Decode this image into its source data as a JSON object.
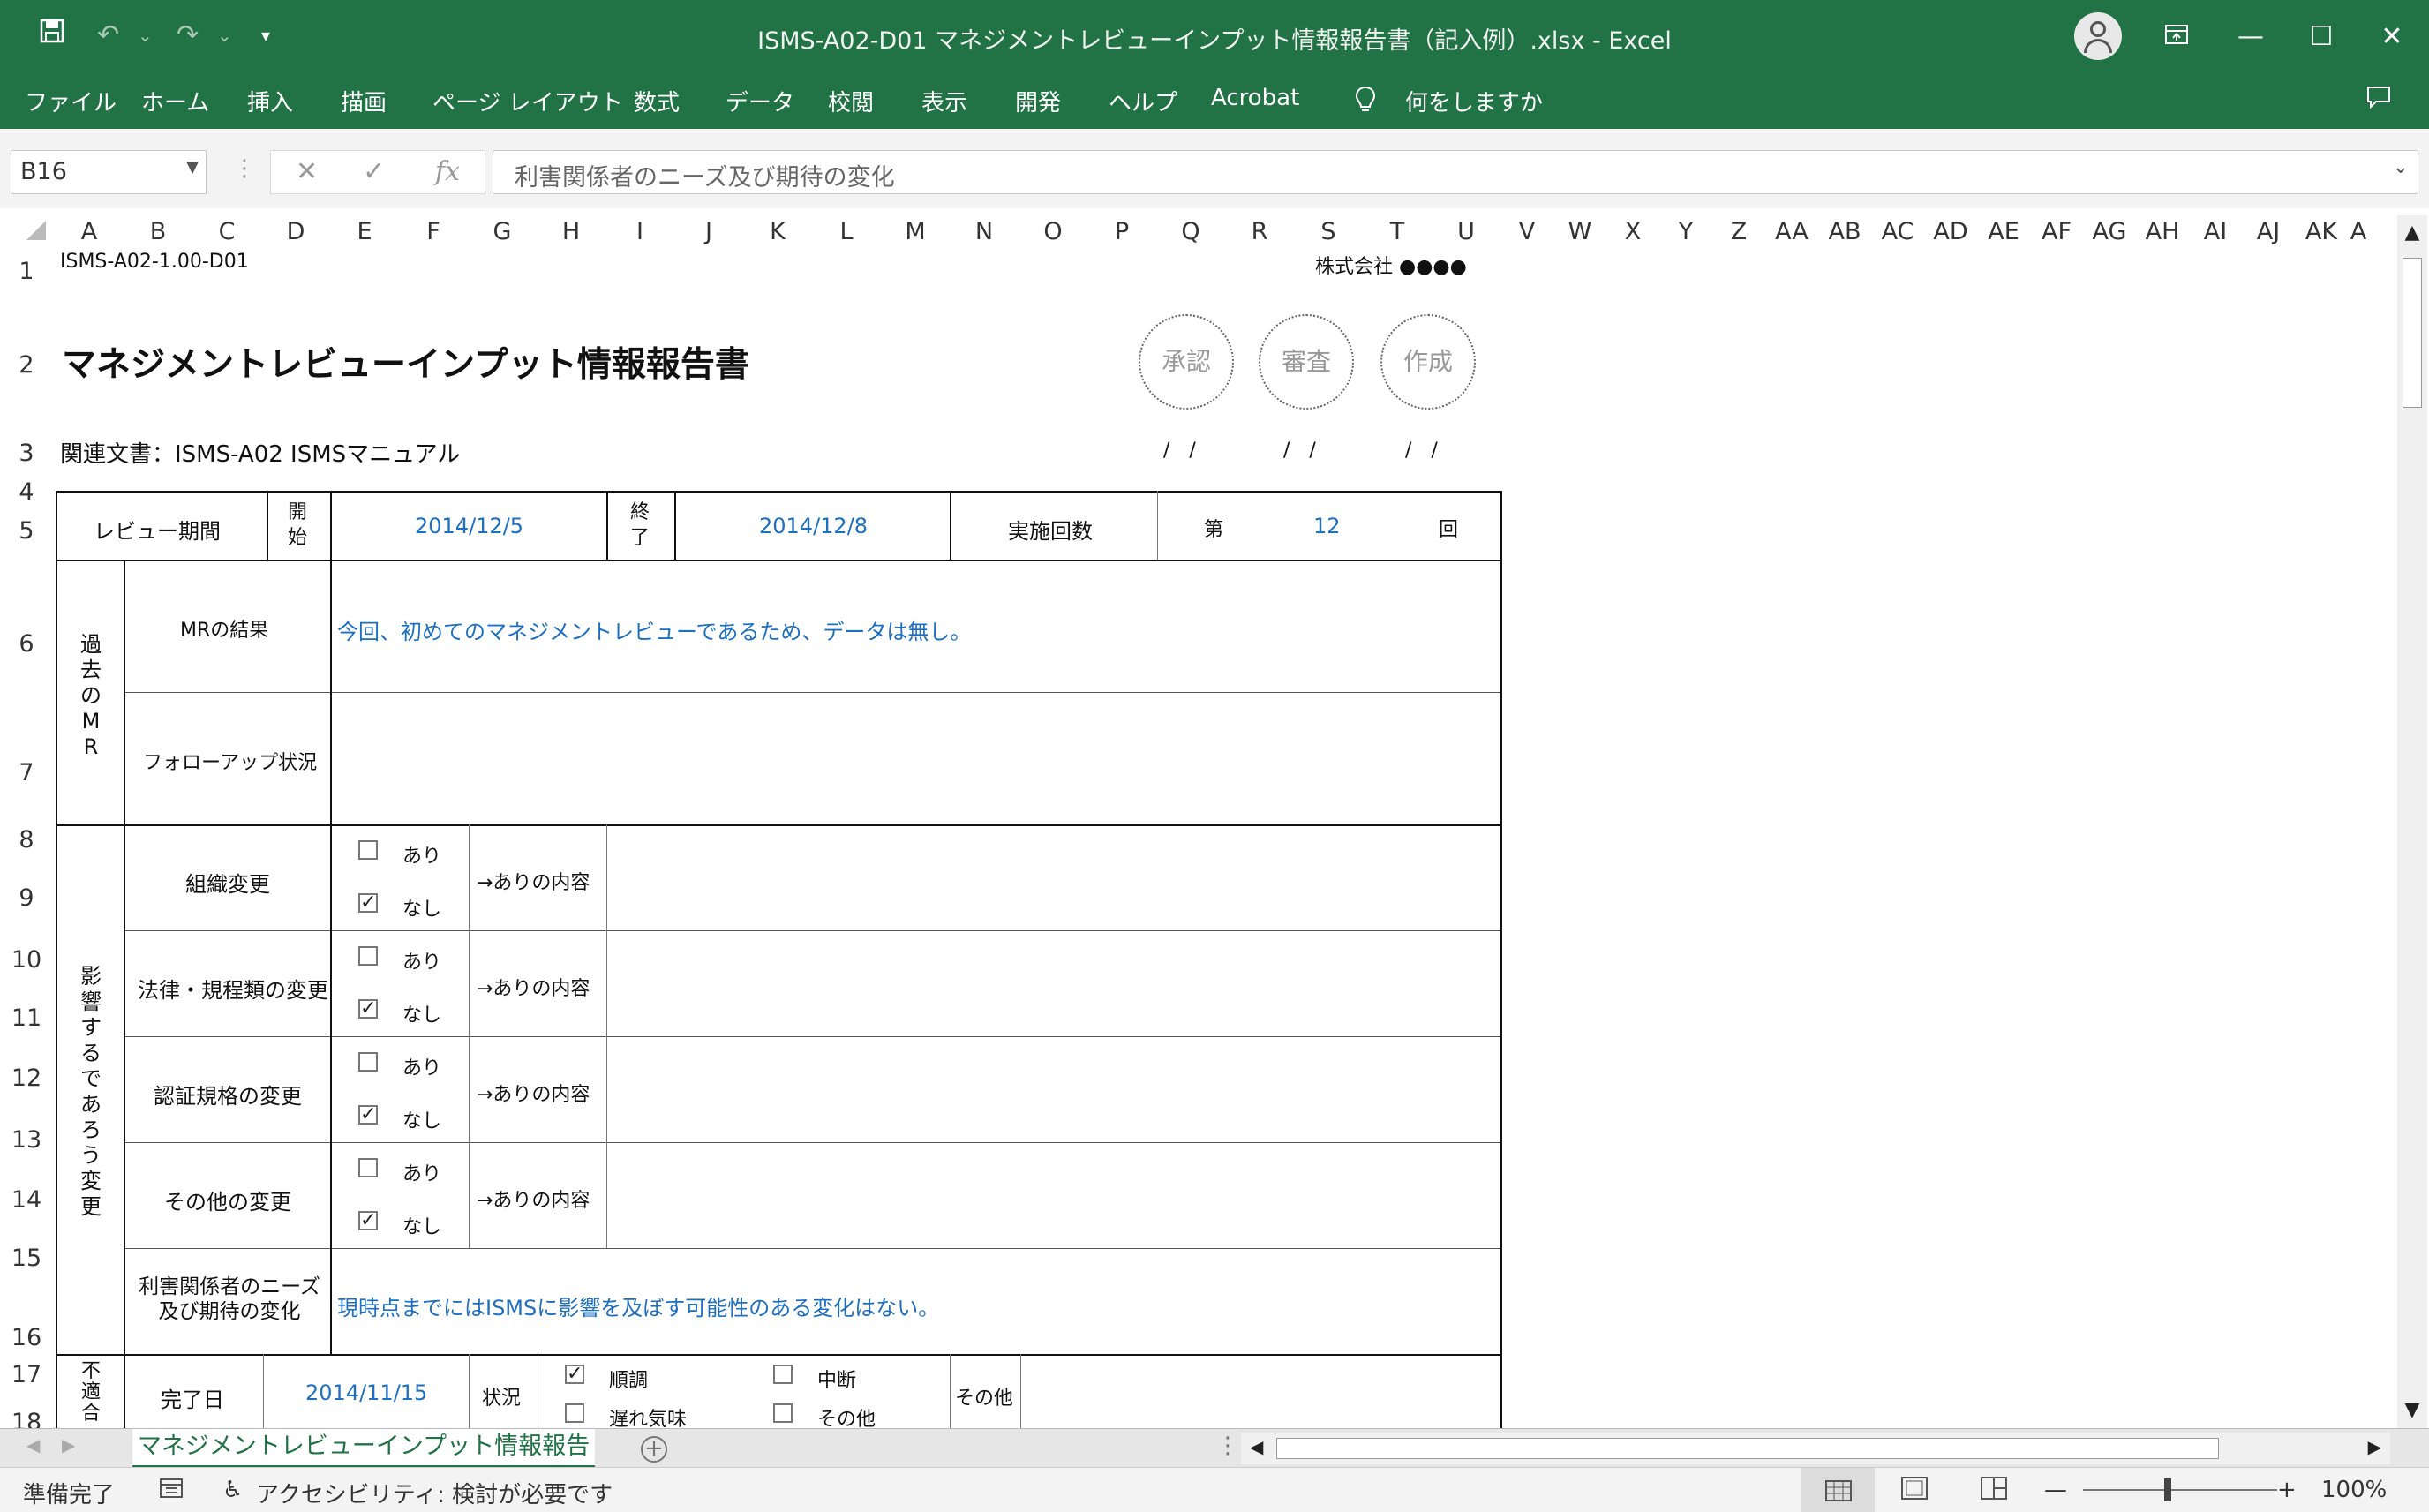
{
  "window": {
    "title": "ISMS-A02-D01 マネジメントレビューインプット情報報告書（記入例）.xlsx  -  Excel"
  },
  "menu": [
    "ファイル",
    "ホーム",
    "挿入",
    "描画",
    "ページ レイアウト",
    "数式",
    "データ",
    "校閲",
    "表示",
    "開発",
    "ヘルプ",
    "Acrobat"
  ],
  "tell_me": "何をしますか",
  "formula_bar": {
    "name_box": "B16",
    "content": "利害関係者のニーズ及び期待の変化"
  },
  "columns": [
    "A",
    "B",
    "C",
    "D",
    "E",
    "F",
    "G",
    "H",
    "I",
    "J",
    "K",
    "L",
    "M",
    "N",
    "O",
    "P",
    "Q",
    "R",
    "S",
    "T",
    "U",
    "V",
    "W",
    "X",
    "Y",
    "Z",
    "AA",
    "AB",
    "AC",
    "AD",
    "AE",
    "AF",
    "AG",
    "AH",
    "AI",
    "AJ",
    "AK",
    "A"
  ],
  "rows": [
    "1",
    "2",
    "3",
    "4",
    "5",
    "6",
    "7",
    "8",
    "9",
    "10",
    "11",
    "12",
    "13",
    "14",
    "15",
    "16",
    "17",
    "18"
  ],
  "sheet": {
    "doc_id": "ISMS-A02-1.00-D01",
    "company": "株式会社 ●●●●",
    "title": "マネジメントレビューインプット情報報告書",
    "related_doc": "関連文書：ISMS-A02 ISMSマニュアル",
    "stamps": [
      "承認",
      "審査",
      "作成"
    ],
    "date_slash": "/　/",
    "review_period_label": "レビュー期間",
    "start_label": [
      "開",
      "始"
    ],
    "start_date": "2014/12/5",
    "end_label": [
      "終",
      "了"
    ],
    "end_date": "2014/12/8",
    "count_label": "実施回数",
    "count_prefix": "第",
    "count_value": "12",
    "count_suffix": "回",
    "past_mr_label": [
      "過",
      "去",
      "の",
      "M",
      "R"
    ],
    "mr_result_label": "MRの結果",
    "mr_result_text": "今回、初めてのマネジメントレビューであるため、データは無し。",
    "followup_label": "フォローアップ状況",
    "impact_label": [
      "影",
      "響",
      "す",
      "る",
      "で",
      "あ",
      "ろ",
      "う",
      "変",
      "更"
    ],
    "changes": [
      {
        "label": "組織変更",
        "ari": "あり",
        "nashi": "なし",
        "detail": "→ありの内容"
      },
      {
        "label": "法律・規程類の変更",
        "ari": "あり",
        "nashi": "なし",
        "detail": "→ありの内容"
      },
      {
        "label": "認証規格の変更",
        "ari": "あり",
        "nashi": "なし",
        "detail": "→ありの内容"
      },
      {
        "label": "その他の変更",
        "ari": "あり",
        "nashi": "なし",
        "detail": "→ありの内容"
      }
    ],
    "stakeholder_label": [
      "利害関係者のニーズ",
      "及び期待の変化"
    ],
    "stakeholder_text": "現時点までにはISMSに影響を及ぼす可能性のある変化はない。",
    "nc_label": [
      "不",
      "適",
      "合"
    ],
    "completion_label": "完了日",
    "completion_date": "2014/11/15",
    "status_label": "状況",
    "status_options": [
      "順調",
      "中断",
      "遅れ気味",
      "その他"
    ],
    "other_label": "その他"
  },
  "sheet_tab": "マネジメントレビューインプット情報報告書",
  "status": {
    "ready": "準備完了",
    "accessibility": "アクセシビリティ: 検討が必要です",
    "zoom": "100%"
  }
}
